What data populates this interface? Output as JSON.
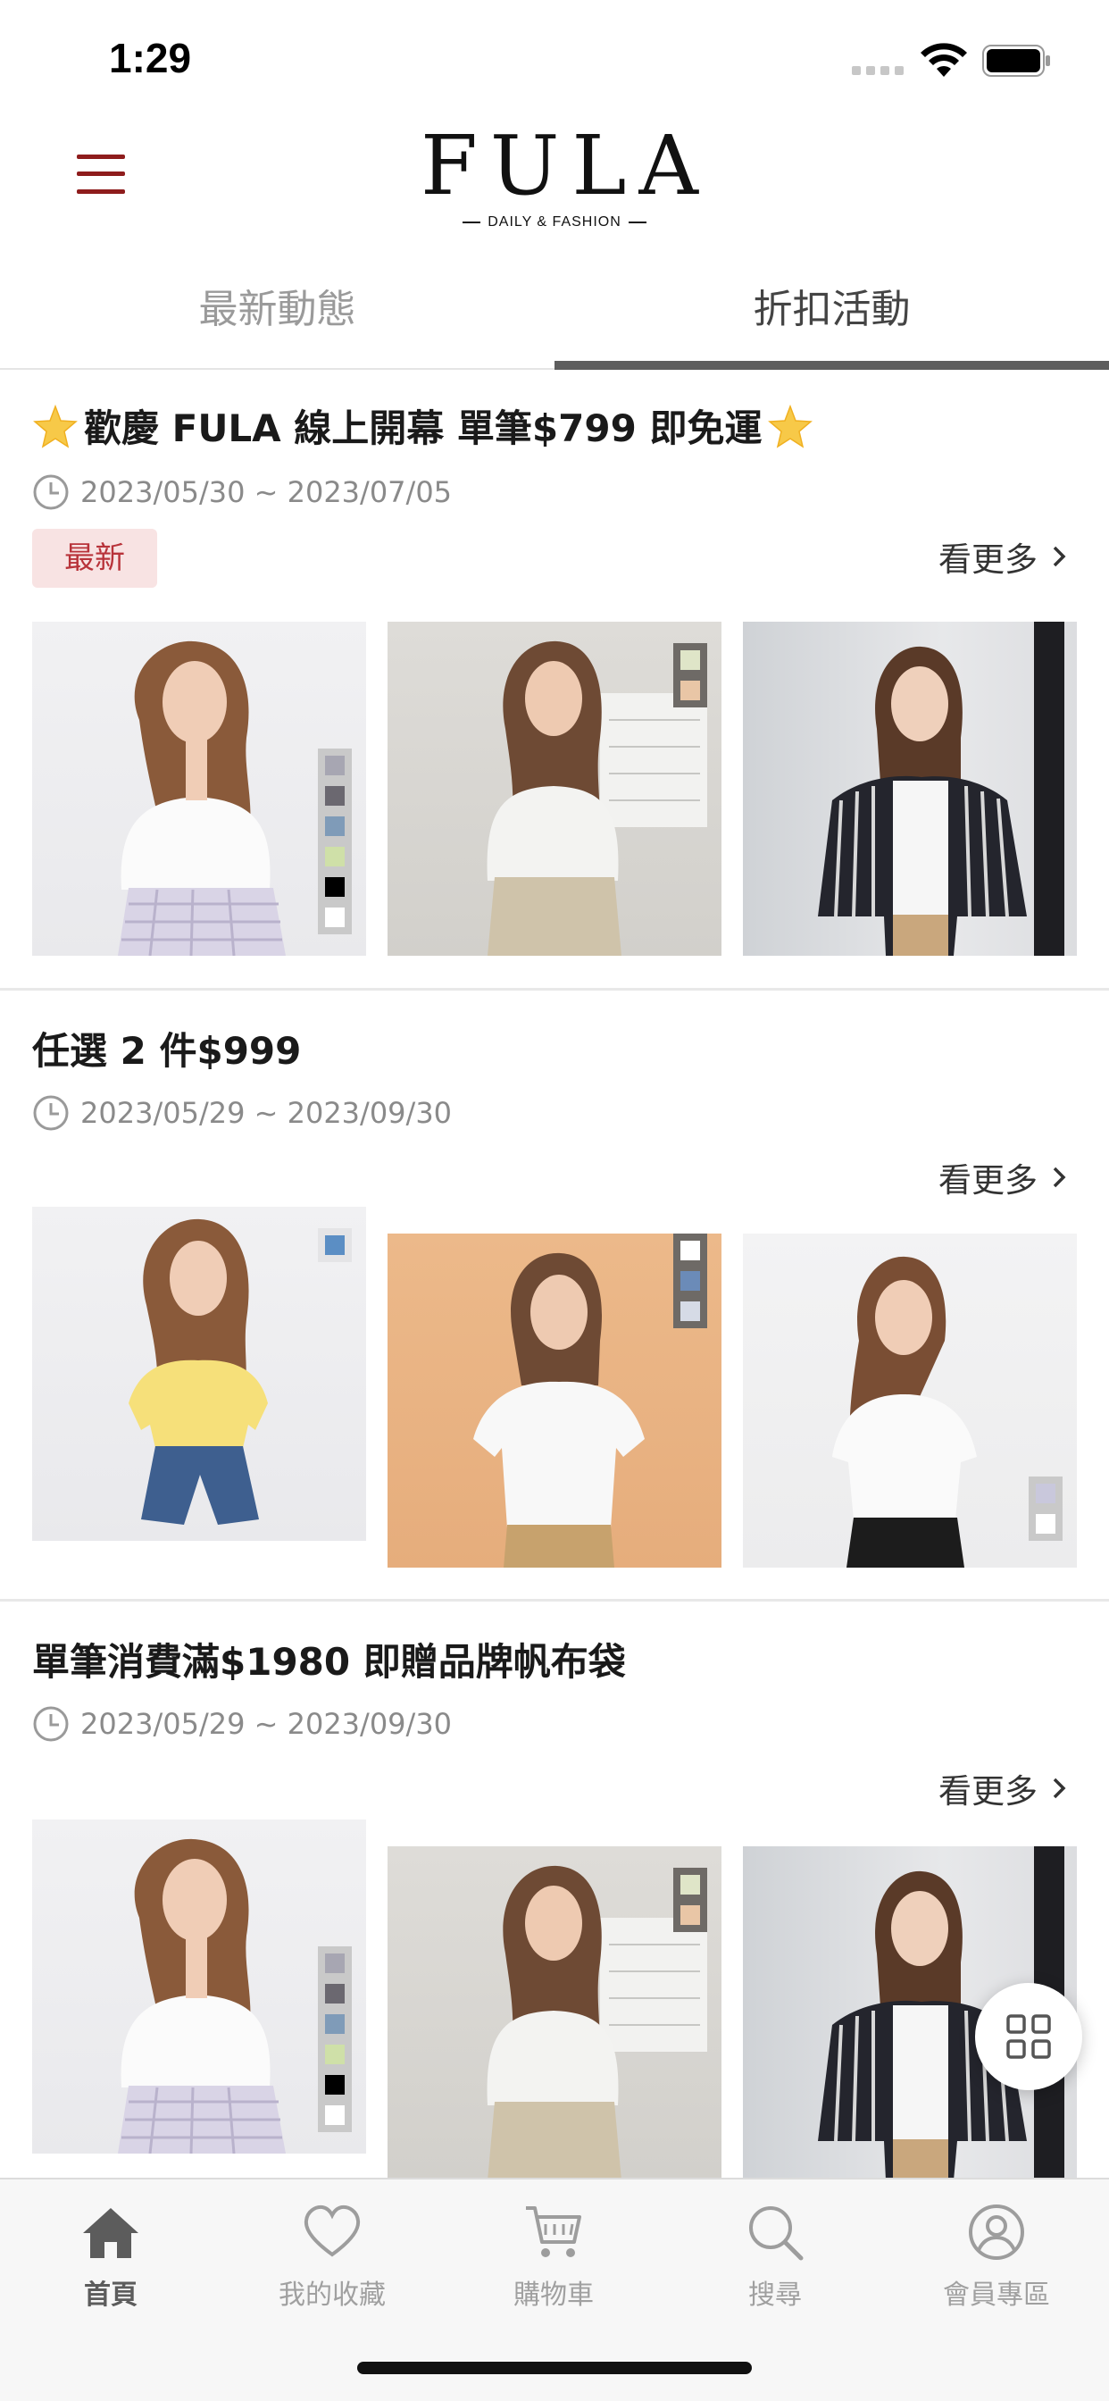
{
  "status_bar": {
    "time": "1:29"
  },
  "header": {
    "logo_text": "FULA",
    "logo_tagline": "DAILY & FASHION"
  },
  "tabs": [
    {
      "label": "最新動態",
      "active": false
    },
    {
      "label": "折扣活動",
      "active": true
    }
  ],
  "promotions": [
    {
      "title": "歡慶 FULA 線上開幕 單筆$799 即免運",
      "title_icons": [
        "star-icon",
        "star-icon"
      ],
      "date_range": "2023/05/30 ~ 2023/07/05",
      "badge": "最新",
      "see_more": "看更多",
      "products": [
        {
          "description_icon": "model-white-tee-plaid-skirt",
          "swatches": [
            "#a7a6b2",
            "#6b6870",
            "#7f9bb8",
            "#cfe0a8",
            "#000000",
            "#ffffff"
          ]
        },
        {
          "description_icon": "model-white-knit-beige-shorts",
          "swatches": [
            "#dfe5c8",
            "#e9c6a6"
          ]
        },
        {
          "description_icon": "model-striped-shirt",
          "swatches": []
        }
      ]
    },
    {
      "title": "任選 2 件$999",
      "date_range": "2023/05/29 ~ 2023/09/30",
      "see_more": "看更多",
      "products": [
        {
          "description_icon": "model-yellow-top-denim-shorts",
          "swatches": [
            "#5b8ec4"
          ]
        },
        {
          "description_icon": "model-white-polo-khaki",
          "swatches": [
            "#ffffff",
            "#6b8bb8",
            "#d6dbe6"
          ]
        },
        {
          "description_icon": "model-white-tee-black-skirt",
          "swatches": [
            "#c9c8dc",
            "#ffffff"
          ]
        }
      ]
    },
    {
      "title": "單筆消費滿$1980 即贈品牌帆布袋",
      "date_range": "2023/05/29 ~ 2023/09/30",
      "see_more": "看更多",
      "products": [
        {
          "description_icon": "model-white-tee-plaid-skirt",
          "swatches": [
            "#a7a6b2",
            "#6b6870",
            "#7f9bb8",
            "#cfe0a8",
            "#000000",
            "#ffffff"
          ]
        },
        {
          "description_icon": "model-white-knit-beige-shorts",
          "swatches": [
            "#dfe5c8",
            "#e9c6a6"
          ]
        },
        {
          "description_icon": "model-striped-shirt",
          "swatches": []
        }
      ]
    }
  ],
  "bottom_nav": [
    {
      "label": "首頁",
      "icon": "home-icon",
      "active": true
    },
    {
      "label": "我的收藏",
      "icon": "heart-icon",
      "active": false
    },
    {
      "label": "購物車",
      "icon": "cart-icon",
      "active": false
    },
    {
      "label": "搜尋",
      "icon": "search-icon",
      "active": false
    },
    {
      "label": "會員專區",
      "icon": "user-icon",
      "active": false
    }
  ],
  "colors": {
    "accent": "#8e1c1c",
    "badge_bg": "#f8e3e3",
    "badge_text": "#b8333a",
    "tab_active_underline": "#5d5d5d"
  }
}
